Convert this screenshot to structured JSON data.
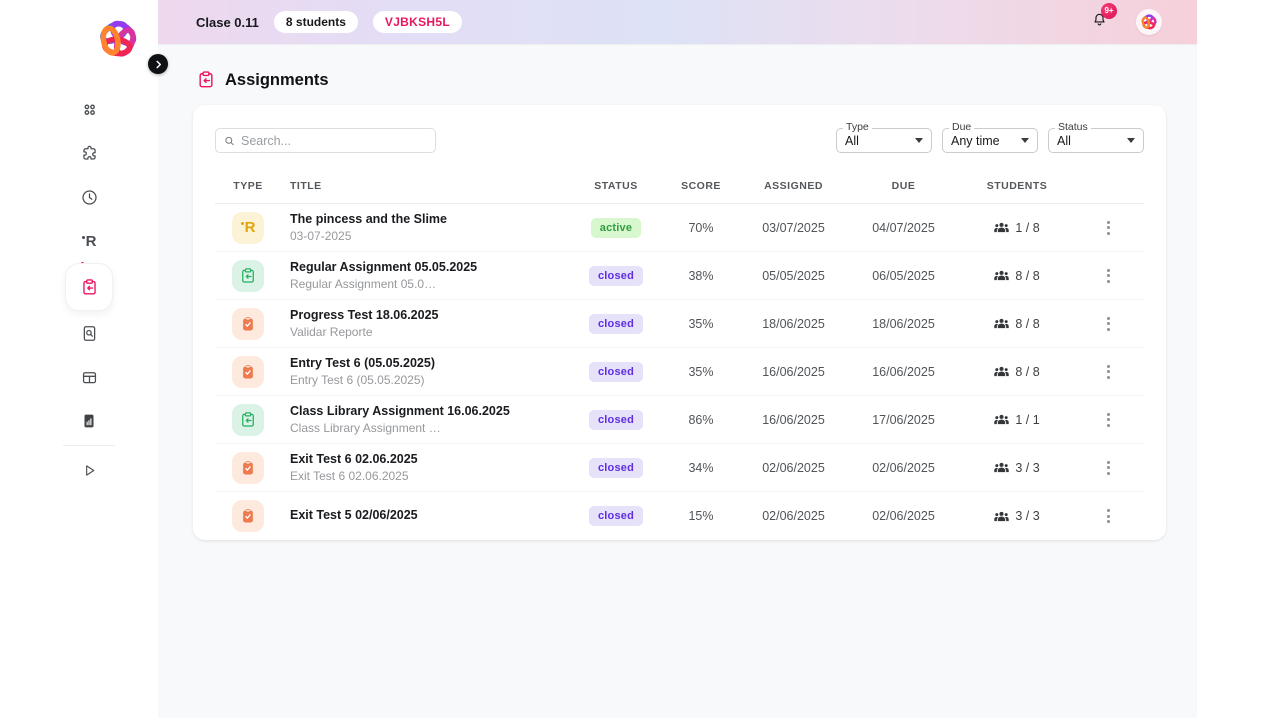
{
  "topbar": {
    "class_name": "Clase 0.11",
    "students_badge": "8 students",
    "class_code": "VJBKSH5L",
    "notification_count": "9+"
  },
  "page": {
    "title": "Assignments"
  },
  "filters": {
    "search_placeholder": "Search...",
    "type": {
      "label": "Type",
      "value": "All"
    },
    "due": {
      "label": "Due",
      "value": "Any time"
    },
    "status": {
      "label": "Status",
      "value": "All"
    }
  },
  "table": {
    "headers": [
      "TYPE",
      "TITLE",
      "STATUS",
      "SCORE",
      "ASSIGNED",
      "DUE",
      "STUDENTS"
    ],
    "rows": [
      {
        "type_icon": "reader",
        "title": "The pincess and the Slime",
        "subtitle": "03-07-2025",
        "status": "active",
        "score": "70%",
        "assigned": "03/07/2025",
        "due": "04/07/2025",
        "students": "1 / 8"
      },
      {
        "type_icon": "assignment",
        "title": "Regular Assignment 05.05.2025",
        "subtitle": "Regular Assignment 05.0…",
        "status": "closed",
        "score": "38%",
        "assigned": "05/05/2025",
        "due": "06/05/2025",
        "students": "8 / 8"
      },
      {
        "type_icon": "test",
        "title": "Progress Test 18.06.2025",
        "subtitle": "Validar Reporte",
        "status": "closed",
        "score": "35%",
        "assigned": "18/06/2025",
        "due": "18/06/2025",
        "students": "8 / 8"
      },
      {
        "type_icon": "test",
        "title": "Entry Test 6 (05.05.2025)",
        "subtitle": "Entry Test 6 (05.05.2025)",
        "status": "closed",
        "score": "35%",
        "assigned": "16/06/2025",
        "due": "16/06/2025",
        "students": "8 / 8"
      },
      {
        "type_icon": "assignment",
        "title": "Class Library Assignment 16.06.2025",
        "subtitle": "Class Library Assignment …",
        "status": "closed",
        "score": "86%",
        "assigned": "16/06/2025",
        "due": "17/06/2025",
        "students": "1 / 1"
      },
      {
        "type_icon": "test",
        "title": "Exit Test 6 02.06.2025",
        "subtitle": "Exit Test 6 02.06.2025",
        "status": "closed",
        "score": "34%",
        "assigned": "02/06/2025",
        "due": "02/06/2025",
        "students": "3 / 3"
      },
      {
        "type_icon": "test",
        "title": "Exit Test 5 02/06/2025",
        "subtitle": "",
        "status": "closed",
        "score": "15%",
        "assigned": "02/06/2025",
        "due": "02/06/2025",
        "students": "3 / 3"
      }
    ]
  },
  "sidebar": {
    "icons": [
      "apps-grid",
      "puzzle",
      "clock",
      "reader",
      "assignments",
      "file-search",
      "kanban",
      "report",
      "play"
    ],
    "active_item": "assignments"
  },
  "colors": {
    "accent_pink": "#ec1262",
    "badge_active": {
      "bg": "#d8f7cf",
      "text": "#2f9e3f"
    },
    "badge_closed": {
      "bg": "#e6e2f9",
      "text": "#5f2ee0"
    },
    "type_reader": "#e2a40a",
    "type_assignment": "#27ae60",
    "type_test": "#f07a4e"
  }
}
